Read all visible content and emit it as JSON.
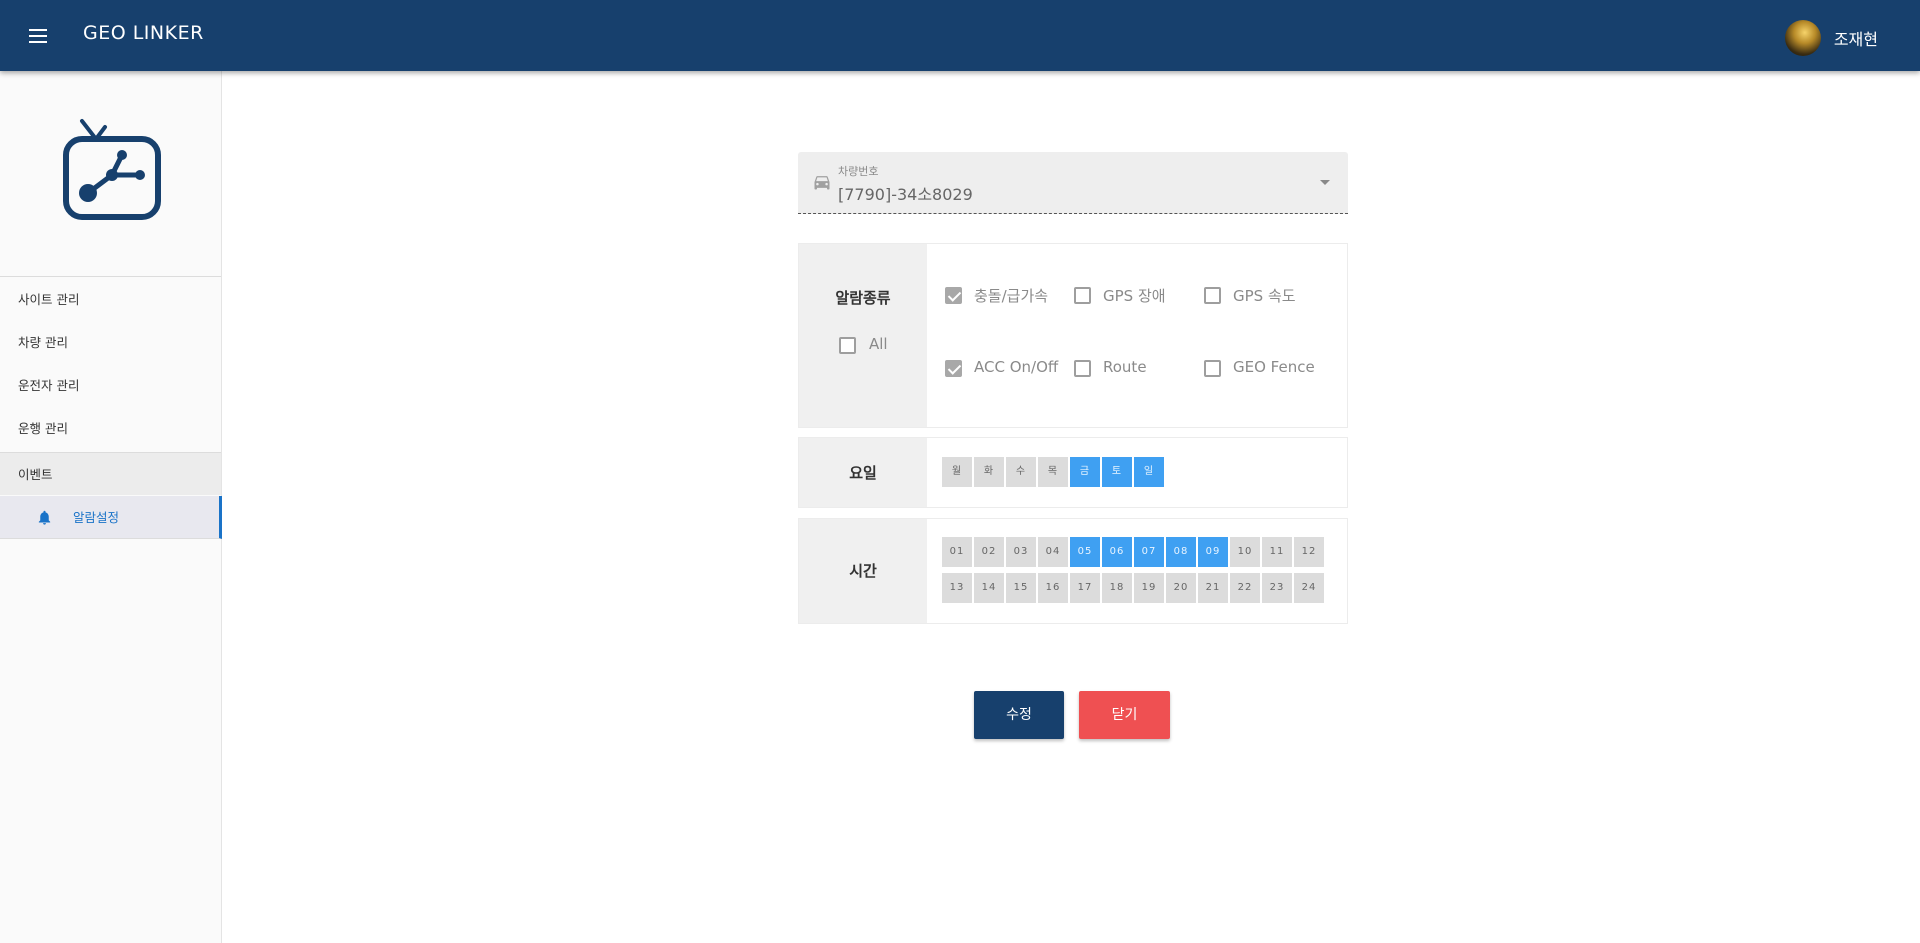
{
  "header": {
    "app_title": "GEO LINKER",
    "user_name": "조재현"
  },
  "sidebar": {
    "items": [
      {
        "label": "사이트 관리"
      },
      {
        "label": "차량 관리"
      },
      {
        "label": "운전자 관리"
      },
      {
        "label": "운행 관리"
      }
    ],
    "group_label": "이벤트",
    "sub_item": {
      "label": "알람설정",
      "active": true
    }
  },
  "vehicle": {
    "label": "차량번호",
    "value": "[7790]-34소8029"
  },
  "alarm_type": {
    "label": "알람종류",
    "all": {
      "label": "All",
      "checked": false
    },
    "options": [
      {
        "label": "충돌/급가속",
        "checked": true
      },
      {
        "label": "GPS 장애",
        "checked": false
      },
      {
        "label": "GPS 속도",
        "checked": false
      },
      {
        "label": "ACC On/Off",
        "checked": true
      },
      {
        "label": "Route",
        "checked": false
      },
      {
        "label": "GEO Fence",
        "checked": false
      }
    ]
  },
  "weekday": {
    "label": "요일",
    "days": [
      {
        "label": "월",
        "selected": false
      },
      {
        "label": "화",
        "selected": false
      },
      {
        "label": "수",
        "selected": false
      },
      {
        "label": "목",
        "selected": false
      },
      {
        "label": "금",
        "selected": true
      },
      {
        "label": "토",
        "selected": true
      },
      {
        "label": "일",
        "selected": true
      }
    ]
  },
  "time": {
    "label": "시간",
    "hours": [
      {
        "label": "01",
        "selected": false
      },
      {
        "label": "02",
        "selected": false
      },
      {
        "label": "03",
        "selected": false
      },
      {
        "label": "04",
        "selected": false
      },
      {
        "label": "05",
        "selected": true
      },
      {
        "label": "06",
        "selected": true
      },
      {
        "label": "07",
        "selected": true
      },
      {
        "label": "08",
        "selected": true
      },
      {
        "label": "09",
        "selected": true
      },
      {
        "label": "10",
        "selected": false
      },
      {
        "label": "11",
        "selected": false
      },
      {
        "label": "12",
        "selected": false
      },
      {
        "label": "13",
        "selected": false
      },
      {
        "label": "14",
        "selected": false
      },
      {
        "label": "15",
        "selected": false
      },
      {
        "label": "16",
        "selected": false
      },
      {
        "label": "17",
        "selected": false
      },
      {
        "label": "18",
        "selected": false
      },
      {
        "label": "19",
        "selected": false
      },
      {
        "label": "20",
        "selected": false
      },
      {
        "label": "21",
        "selected": false
      },
      {
        "label": "22",
        "selected": false
      },
      {
        "label": "23",
        "selected": false
      },
      {
        "label": "24",
        "selected": false
      }
    ]
  },
  "actions": {
    "edit_label": "수정",
    "close_label": "닫기"
  },
  "colors": {
    "brand": "#17406d",
    "selected": "#3fa0f2",
    "close": "#ef5052"
  },
  "icons": {
    "menu": "menu-icon",
    "logo": "geo-linker-logo",
    "bell": "bell-icon",
    "car": "car-icon",
    "caret": "caret-down-icon"
  }
}
